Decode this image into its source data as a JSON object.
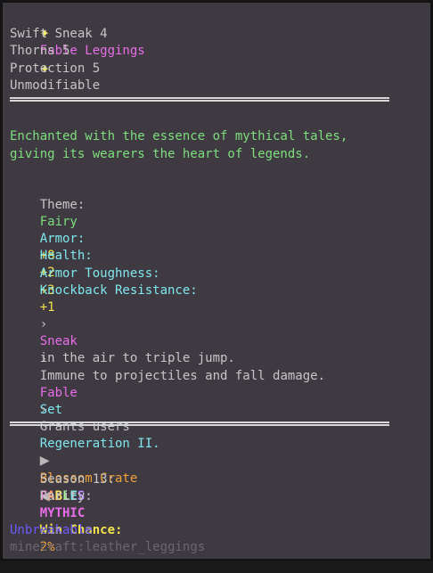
{
  "item": {
    "name": "Fable Leggings",
    "star_icon": "sparkle-star"
  },
  "enchantments": [
    "Swift Sneak 4",
    "Thorns 5",
    "Protection 5",
    "Unmodifiable"
  ],
  "description": {
    "line1": "Enchanted with the essence of mythical tales,",
    "line2": "giving its wearers the heart of legends."
  },
  "theme": {
    "label": "Theme:",
    "value": "Fairy"
  },
  "stats": [
    {
      "label": "Armor:",
      "value": "+8"
    },
    {
      "label": "Health:",
      "value": "+2"
    },
    {
      "label": "Armor Toughness:",
      "value": "+3"
    },
    {
      "label": "Knockback Resistance:",
      "value": "+1"
    }
  ],
  "abilities": {
    "bullet": "›",
    "a1_keyword": "Sneak",
    "a1_rest": "in the air to triple jump.",
    "a2": "Immune to projectiles and fall damage."
  },
  "set": {
    "name_part1": "Fable",
    "name_part2": "Set",
    "grant_prefix": "Grants users",
    "grant_value": "Regeneration II."
  },
  "crate": {
    "name": "Blossom Crate",
    "season_label": "Season 13:",
    "season_value": "FABLES",
    "rarity_label": "Rarity:",
    "rarity_value": "MYTHIC"
  },
  "win": {
    "label": "Win Chance:",
    "value": "2%"
  },
  "unbreakable": "Unbreakable",
  "item_id": "minecraft:leather_leggings",
  "colors": {
    "background": "#3f3a42",
    "green": "#7ddf7d",
    "aqua": "#7fe7ee",
    "yellow": "#f2e34d",
    "pink": "#e96de9",
    "purple": "#a884ff"
  }
}
